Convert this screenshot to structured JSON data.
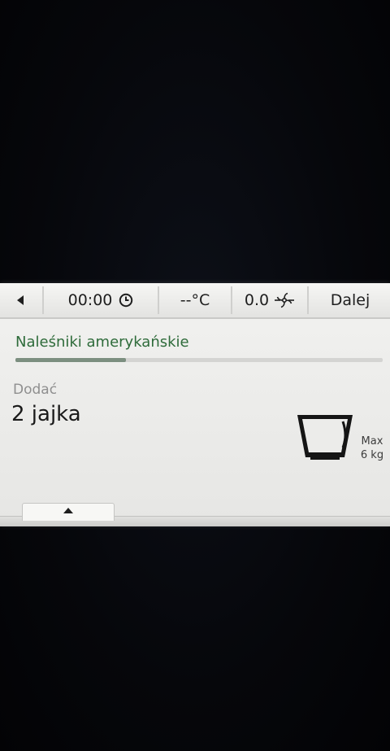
{
  "toolbar": {
    "timer": "00:00",
    "temperature": "--°C",
    "speed": "0.0",
    "next_label": "Dalej"
  },
  "recipe": {
    "title": "Naleśniki amerykańskie",
    "progress": 0.3
  },
  "step": {
    "label": "Dodać",
    "value": "2 jajka"
  },
  "scale": {
    "max_label": "Max",
    "max_value": "6 kg"
  },
  "icons": {
    "back": "triangle-left-icon",
    "timer": "clock-icon",
    "speed": "fan-speed-icon",
    "scale": "bowl-icon",
    "expand": "triangle-up-icon"
  },
  "colors": {
    "title_green": "#2e6b3a",
    "progress_fill": "#7c8f80"
  }
}
